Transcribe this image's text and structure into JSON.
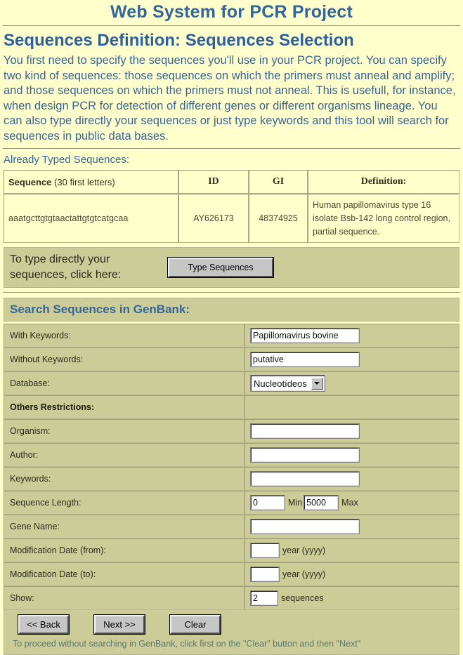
{
  "header": {
    "app_title": "Web System for PCR Project",
    "page_title": "Sequences Definition: Sequences Selection",
    "intro": "You first need to specify the sequences you'll use in your PCR project. You can specify two kind of sequences: those sequences on which the primers must anneal and amplify; and those sequences on which the primers must not anneal. This is usefull, for instance, when design PCR for detection of different genes or different organisms lineage. You can also type directly your sequences or just type keywords and this tool will search for sequences in public data bases."
  },
  "typed_sequences": {
    "section_label": "Already Typed Sequences:",
    "columns": {
      "sequence_bold": "Sequence",
      "sequence_thin": "(30 first letters)",
      "id": "ID",
      "gi": "GI",
      "definition": "Definition:"
    },
    "rows": [
      {
        "sequence": "aaatgcttgtgtaactattgtgtcatgcaa",
        "id": "AY626173",
        "gi": "48374925",
        "definition": "Human papillomavirus type 16 isolate Bsb-142 long control region, partial sequence."
      }
    ]
  },
  "type_directly": {
    "text": "To type directly your sequences, click here:",
    "button_label": "Type Sequences"
  },
  "search": {
    "heading": "Search Sequences in GenBank:",
    "fields": {
      "with_keywords_label": "With Keywords:",
      "with_keywords_value": "Papillomavirus bovine",
      "without_keywords_label": "Without Keywords:",
      "without_keywords_value": "putative",
      "database_label": "Database:",
      "database_value": "Nucleotídeos",
      "others_restrictions_label": "Others Restrictions:",
      "organism_label": "Organism:",
      "organism_value": "",
      "author_label": "Author:",
      "author_value": "",
      "keywords_label": "Keywords:",
      "keywords_value": "",
      "sequence_length_label": "Sequence Length:",
      "sequence_length_min": "0",
      "sequence_length_min_unit": "Min",
      "sequence_length_max": "5000",
      "sequence_length_max_unit": "Max",
      "gene_name_label": "Gene Name:",
      "gene_name_value": "",
      "mod_date_from_label": "Modification Date (from):",
      "mod_date_from_value": "",
      "mod_date_from_unit": "year (yyyy)",
      "mod_date_to_label": "Modification Date (to):",
      "mod_date_to_value": "",
      "mod_date_to_unit": "year (yyyy)",
      "show_label": "Show:",
      "show_value": "2",
      "show_unit": "sequences"
    }
  },
  "footer": {
    "back_label": "<< Back",
    "next_label": "Next >>",
    "clear_label": "Clear",
    "note": "To proceed without searching in GenBank, click first on the \"Clear\" button and then \"Next\""
  },
  "colors": {
    "page_bg": "#ffffcc",
    "band_bg": "#cccc99",
    "title_blue": "#33669a",
    "intro_blue": "#3a6496",
    "note_green": "#5f7a6a"
  }
}
